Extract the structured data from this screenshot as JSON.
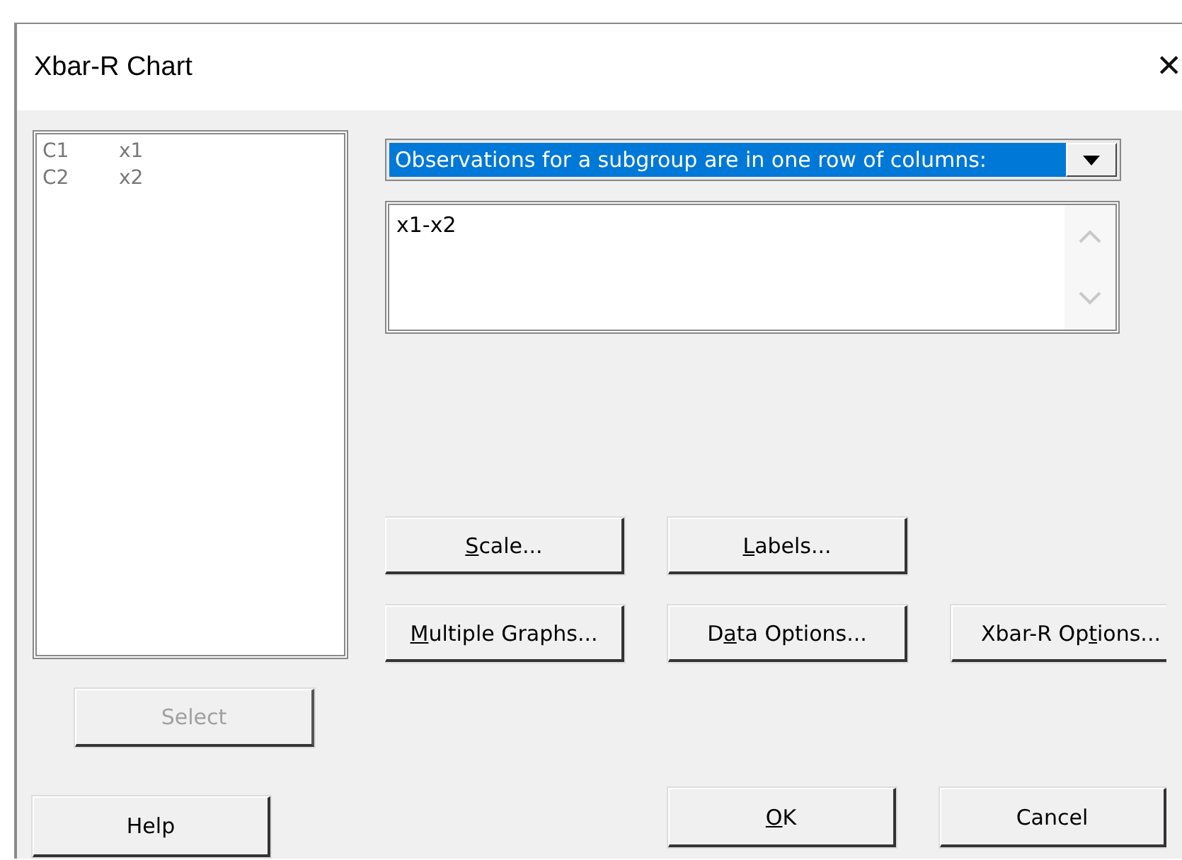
{
  "window": {
    "title": "Xbar-R Chart",
    "close": "✕"
  },
  "variables": [
    {
      "column": "C1",
      "name": "x1"
    },
    {
      "column": "C2",
      "name": "x2"
    }
  ],
  "data_layout": {
    "value": "Observations for a subgroup are in one row of columns:",
    "selected": true
  },
  "columns_field": {
    "value": "x1-x2"
  },
  "select_button": {
    "label": "Select",
    "disabled": true
  },
  "option_buttons": [
    {
      "key": "S",
      "post": "cale..."
    },
    {
      "key": "L",
      "post": "abels..."
    },
    {
      "key": "M",
      "post": "ultiple Graphs..."
    },
    {
      "pre": "D",
      "key": "a",
      "post": "ta Options..."
    },
    {
      "pre": "Xbar-R Op",
      "key": "t",
      "post": "ions..."
    }
  ],
  "help_button": {
    "pre": "Help"
  },
  "dialog_buttons": [
    {
      "key": "O",
      "post": "K"
    },
    {
      "pre": "Cancel"
    }
  ]
}
